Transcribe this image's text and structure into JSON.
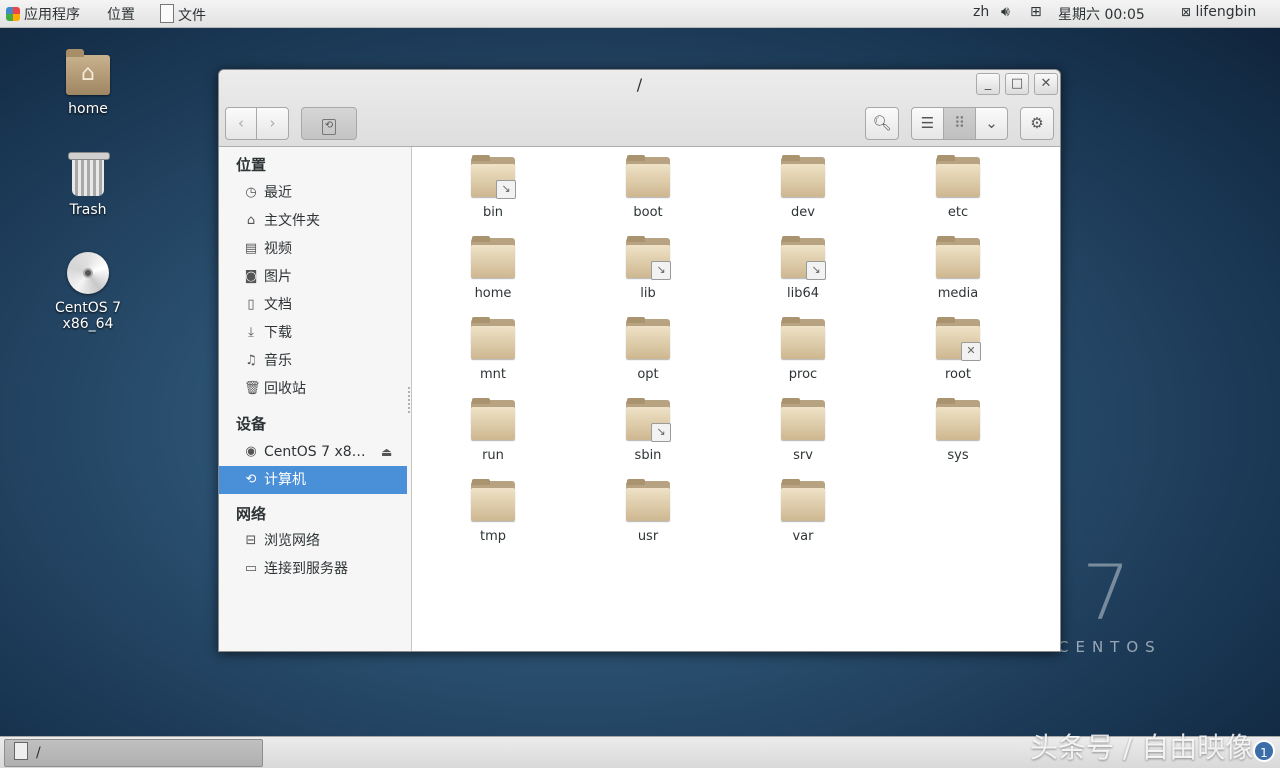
{
  "topbar": {
    "applications": "应用程序",
    "places": "位置",
    "app_menu": "文件",
    "lang": "zh",
    "clock": "星期六 00:05",
    "user": "lifengbin"
  },
  "desktop_icons": [
    {
      "label": "home",
      "icon": "home-folder-icon"
    },
    {
      "label": "Trash",
      "icon": "trash-icon"
    },
    {
      "label": "CentOS 7 x86_64",
      "icon": "optical-disc-icon"
    }
  ],
  "branding": {
    "version": "7",
    "name": "CENTOS"
  },
  "window": {
    "title": "/",
    "sidebar": {
      "places_header": "位置",
      "places": [
        {
          "label": "最近",
          "icon": "recent-icon"
        },
        {
          "label": "主文件夹",
          "icon": "home-icon"
        },
        {
          "label": "视频",
          "icon": "video-icon"
        },
        {
          "label": "图片",
          "icon": "camera-icon"
        },
        {
          "label": "文档",
          "icon": "document-icon"
        },
        {
          "label": "下载",
          "icon": "download-icon"
        },
        {
          "label": "音乐",
          "icon": "music-icon"
        },
        {
          "label": "回收站",
          "icon": "trash-icon"
        }
      ],
      "devices_header": "设备",
      "devices": [
        {
          "label": "CentOS 7 x8…",
          "icon": "disc-icon"
        },
        {
          "label": "计算机",
          "icon": "computer-icon",
          "selected": true
        }
      ],
      "network_header": "网络",
      "network": [
        {
          "label": "浏览网络",
          "icon": "network-icon"
        },
        {
          "label": "连接到服务器",
          "icon": "server-icon"
        }
      ]
    },
    "files": [
      {
        "name": "bin",
        "emblem": "symlink"
      },
      {
        "name": "boot",
        "emblem": ""
      },
      {
        "name": "dev",
        "emblem": ""
      },
      {
        "name": "etc",
        "emblem": ""
      },
      {
        "name": "home",
        "emblem": ""
      },
      {
        "name": "lib",
        "emblem": "symlink"
      },
      {
        "name": "lib64",
        "emblem": "symlink"
      },
      {
        "name": "media",
        "emblem": ""
      },
      {
        "name": "mnt",
        "emblem": ""
      },
      {
        "name": "opt",
        "emblem": ""
      },
      {
        "name": "proc",
        "emblem": ""
      },
      {
        "name": "root",
        "emblem": "no-access"
      },
      {
        "name": "run",
        "emblem": ""
      },
      {
        "name": "sbin",
        "emblem": "symlink"
      },
      {
        "name": "srv",
        "emblem": ""
      },
      {
        "name": "sys",
        "emblem": ""
      },
      {
        "name": "tmp",
        "emblem": ""
      },
      {
        "name": "usr",
        "emblem": ""
      },
      {
        "name": "var",
        "emblem": ""
      }
    ]
  },
  "taskbar": {
    "window_label": "/"
  },
  "watermark": "头条号 / 自由映像",
  "workspace_badge": "1"
}
